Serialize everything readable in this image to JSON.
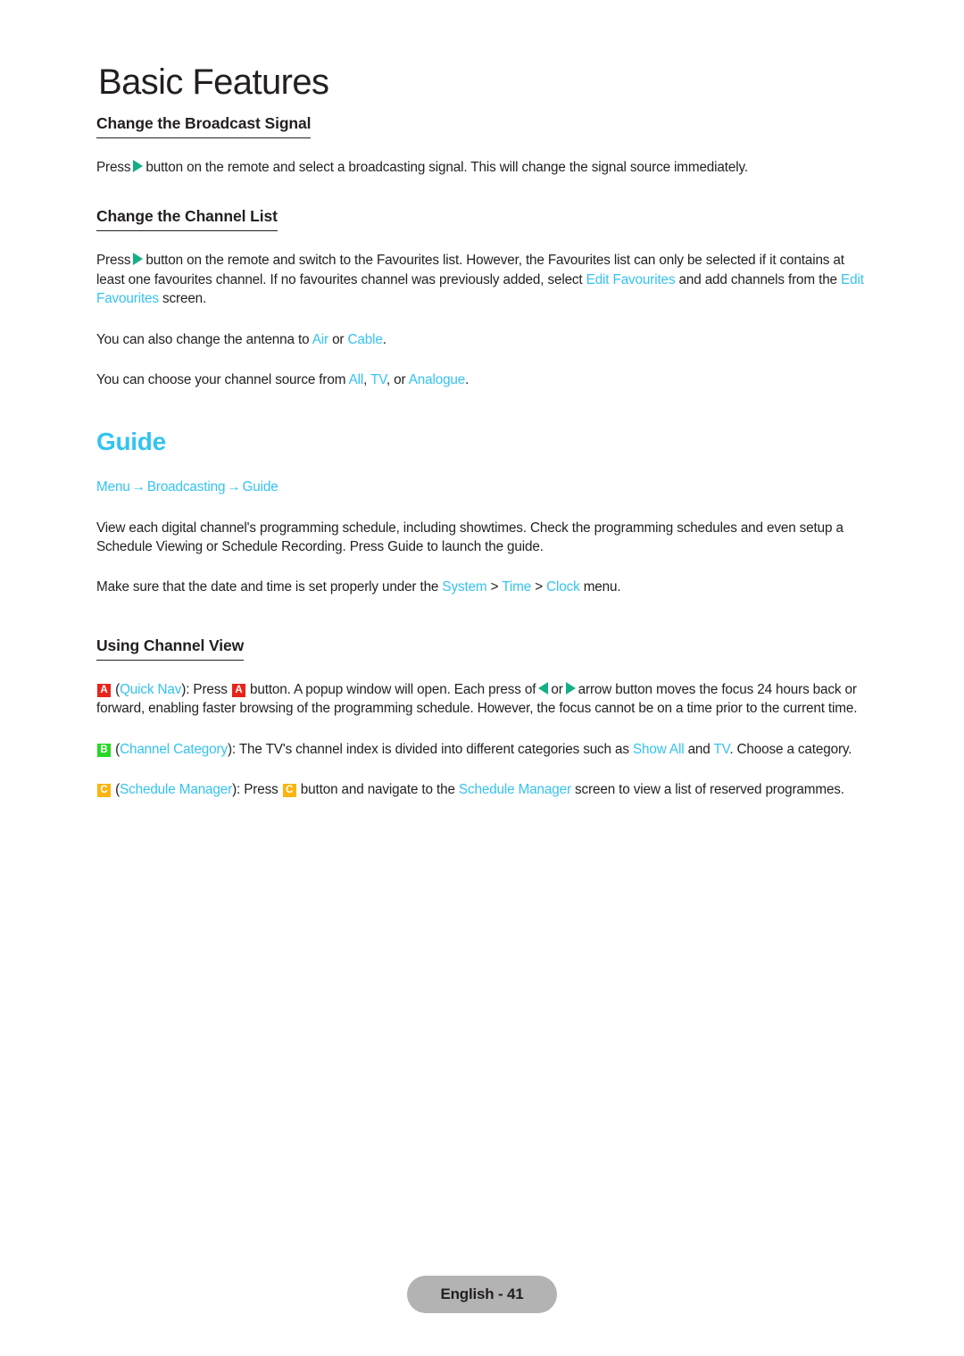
{
  "masthead": "Basic Features",
  "sections": {
    "broadcast_signal": {
      "heading": "Change the Broadcast Signal",
      "para_pre": "Press",
      "para_post": "button on the remote and select a broadcasting signal. This will change the signal source immediately."
    },
    "channel_list": {
      "heading": "Change the Channel List",
      "p1_pre": "Press",
      "p1_a": "button on the remote and switch to the Favourites list. However, the Favourites list can only be selected if it contains at least one favourites channel. If no favourites channel was previously added, select",
      "p1_term1": "Edit Favourites",
      "p1_b": "and add channels from the",
      "p1_term2": "Edit Favourites",
      "p1_c": "screen.",
      "p2_a": "You can also change the antenna to",
      "p2_term1": "Air",
      "p2_b": "or",
      "p2_term2": "Cable",
      "p2_c": ".",
      "p3_a": "You can choose your channel source from",
      "p3_term1": "All",
      "p3_b": ",",
      "p3_term2": "TV",
      "p3_c": ", or",
      "p3_term3": "Analogue",
      "p3_d": "."
    },
    "guide": {
      "heading": "Guide",
      "breadcrumb": {
        "item1": "Menu",
        "arrow1": "→",
        "item2": "Broadcasting",
        "arrow2": "→",
        "item3": "Guide"
      },
      "p1": "View each digital channel's programming schedule, including showtimes. Check the programming schedules and even setup a Schedule Viewing or Schedule Recording. Press Guide to launch the guide.",
      "p2_a": "Make sure that the date and time is set properly under the",
      "p2_term1": "System",
      "p2_gt1": ">",
      "p2_term2": "Time",
      "p2_gt2": ">",
      "p2_term3": "Clock",
      "p2_b": "menu."
    },
    "channel_view": {
      "heading": "Using Channel View",
      "item_a": {
        "key": "A",
        "open_paren": "(",
        "term": "Quick Nav",
        "close_paren": "): Press",
        "key2": "A",
        "text_a": "button. A popup window will open. Each press of",
        "text_or": "or",
        "text_b": "arrow button moves the focus 24 hours back or forward, enabling faster browsing of the programming schedule. However, the focus cannot be on a time prior to the current time."
      },
      "item_b": {
        "key": "B",
        "open_paren": "(",
        "term": "Channel Category",
        "close_paren": "): The TV's channel index is divided into different categories such as",
        "term2": "Show All",
        "text_and": "and",
        "term3": "TV",
        "text_end": ". Choose a category."
      },
      "item_c": {
        "key": "C",
        "open_paren": "(",
        "term": "Schedule Manager",
        "close_paren": "): Press",
        "key2": "C",
        "text_a": "button and navigate to the",
        "term2": "Schedule Manager",
        "text_b": "screen to view a list of reserved programmes."
      }
    }
  },
  "footer": {
    "label": "English - 41"
  },
  "colors": {
    "accent_cyan": "#34c3f0",
    "arrow_green": "#12b087",
    "key_a_red": "#e8241b",
    "key_b_green": "#25d825",
    "key_c_amber": "#fbb510",
    "footer_gray": "#b3b3b3",
    "text": "#231f20"
  }
}
